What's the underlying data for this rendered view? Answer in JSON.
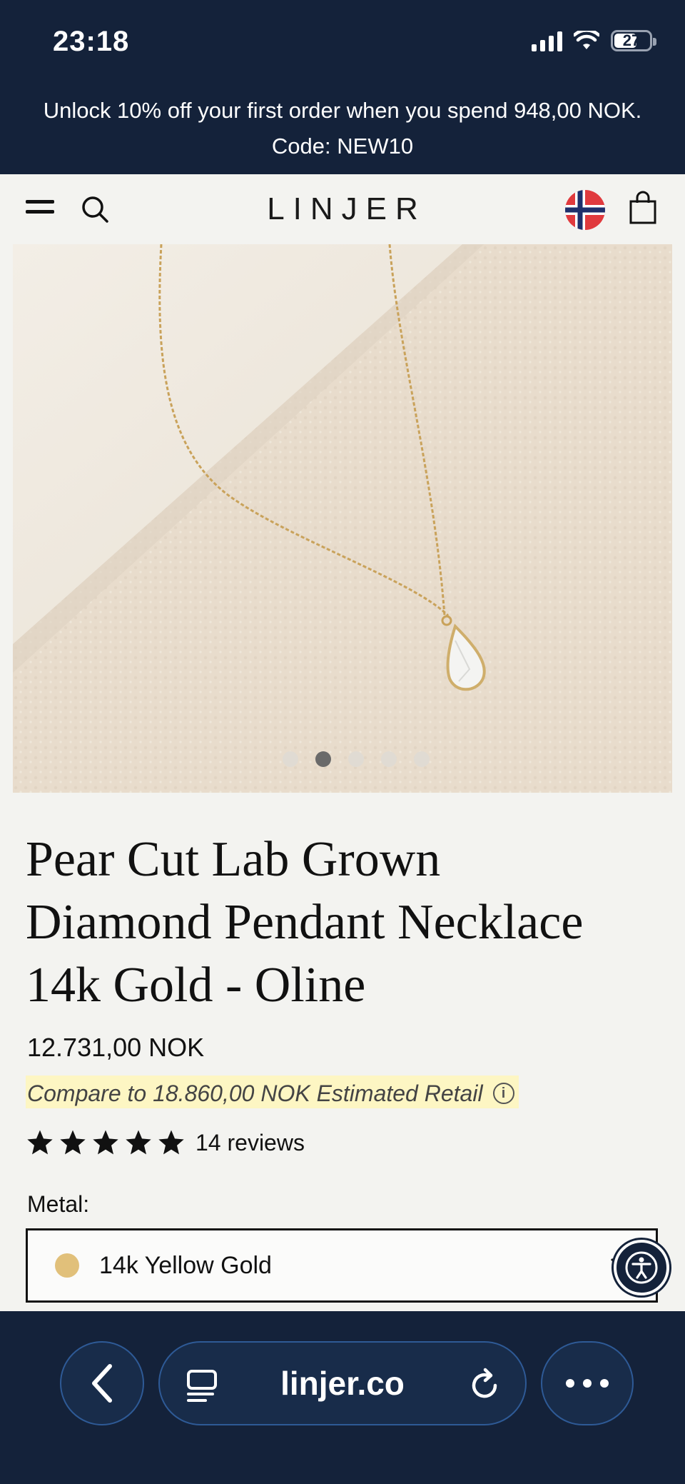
{
  "status_bar": {
    "time": "23:18",
    "battery": "27"
  },
  "promo": {
    "line1": "Unlock 10% off your first order when you spend 948,00 NOK.",
    "line2": "Code: NEW10"
  },
  "header": {
    "logo": "LINJER"
  },
  "product": {
    "title_line1": "Pear Cut Lab Grown",
    "title_line2": "Diamond Pendant Necklace",
    "title_line3": "14k Gold - Oline",
    "price": "12.731,00 NOK",
    "compare": "Compare to 18.860,00 NOK Estimated Retail",
    "rating": 5,
    "reviews": "14 reviews",
    "metal_label": "Metal:",
    "metal_value": "14k Yellow Gold",
    "image_count": 5,
    "active_image": 2
  },
  "browser": {
    "url": "linjer.co"
  },
  "colors": {
    "navy": "#14223a",
    "background": "#f3f3f0",
    "highlight": "#fdf6c3",
    "gold": "#e1c07a"
  }
}
